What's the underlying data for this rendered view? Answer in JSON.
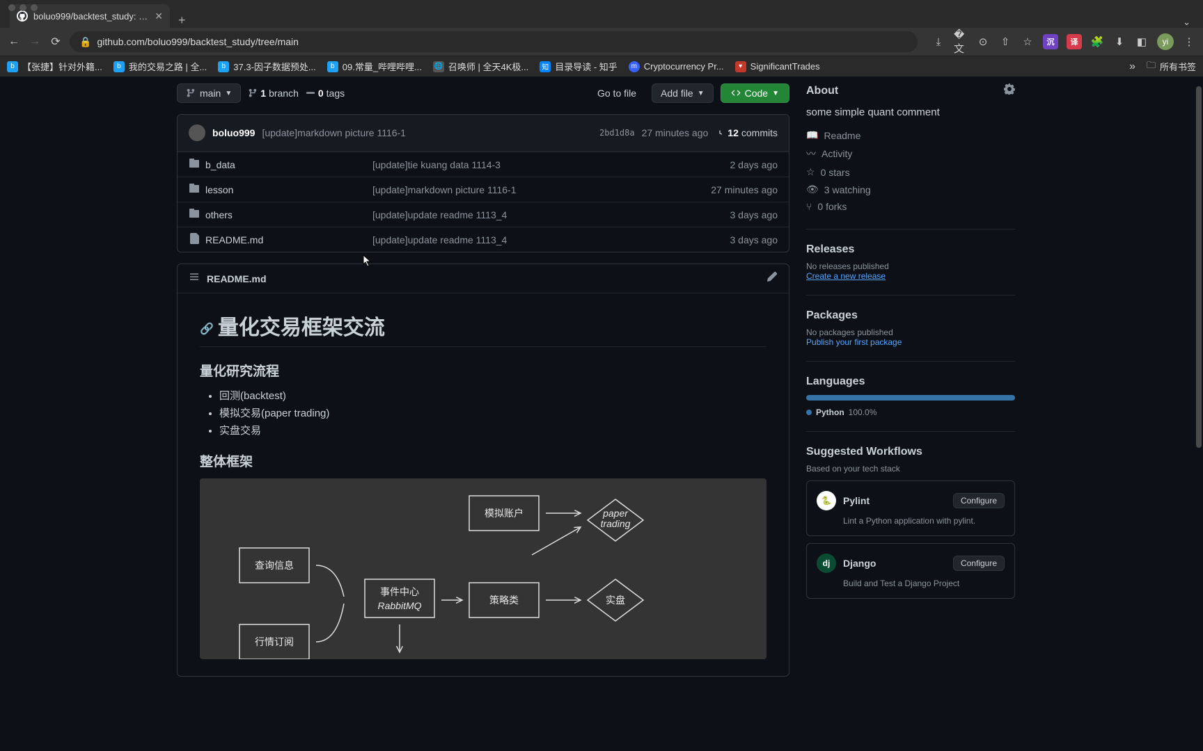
{
  "browser": {
    "tab_title": "boluo999/backtest_study: so…",
    "url": "github.com/boluo999/backtest_study/tree/main"
  },
  "bookmarks": [
    {
      "label": "【张捷】针对外籍...",
      "icon_bg": "#1ea1f2"
    },
    {
      "label": "我的交易之路 | 全...",
      "icon_bg": "#1ea1f2"
    },
    {
      "label": "37.3-因子数据预处...",
      "icon_bg": "#1ea1f2"
    },
    {
      "label": "09.常量_哔哩哔哩...",
      "icon_bg": "#1ea1f2"
    },
    {
      "label": "召唤师 | 全天4K极...",
      "icon_bg": "#555"
    },
    {
      "label": "目录导读 - 知乎",
      "icon_bg": "#0084ff"
    },
    {
      "label": "Cryptocurrency Pr...",
      "icon_bg": "#3861fb"
    },
    {
      "label": "SignificantTrades",
      "icon_bg": "#c0392b"
    }
  ],
  "bookmarks_folder": "所有书签",
  "repo_toolbar": {
    "branch": "main",
    "branches_count": "1",
    "branches_label": "branch",
    "tags_count": "0",
    "tags_label": "tags",
    "go_to_file": "Go to file",
    "add_file": "Add file",
    "code": "Code"
  },
  "commit_header": {
    "user": "boluo999",
    "message": "[update]markdown picture 1116-1",
    "sha": "2bd1d8a",
    "time": "27 minutes ago",
    "commits_count": "12",
    "commits_label": "commits"
  },
  "files": [
    {
      "type": "dir",
      "name": "b_data",
      "msg": "[update]tie kuang data 1114-3",
      "time": "2 days ago"
    },
    {
      "type": "dir",
      "name": "lesson",
      "msg": "[update]markdown picture 1116-1",
      "time": "27 minutes ago"
    },
    {
      "type": "dir",
      "name": "others",
      "msg": "[update]update readme 1113_4",
      "time": "3 days ago"
    },
    {
      "type": "file",
      "name": "README.md",
      "msg": "[update]update readme 1113_4",
      "time": "3 days ago"
    }
  ],
  "readme": {
    "filename": "README.md",
    "h1": "量化交易框架交流",
    "h3a": "量化研究流程",
    "bullets": [
      "回测(backtest)",
      "模拟交易(paper trading)",
      "实盘交易"
    ],
    "h3b": "整体框架",
    "diagram": {
      "box1": "模拟账户",
      "diamond1": "paper trading",
      "box2": "查询信息",
      "box3": "事件中心 RabbitMQ",
      "box4": "策略类",
      "diamond2": "实盘",
      "box5": "行情订阅"
    }
  },
  "sidebar": {
    "about_title": "About",
    "about_desc": "some simple quant comment",
    "links": {
      "readme": "Readme",
      "activity": "Activity",
      "stars": "0 stars",
      "watching": "3 watching",
      "forks": "0 forks"
    },
    "releases_title": "Releases",
    "releases_empty": "No releases published",
    "releases_link": "Create a new release",
    "packages_title": "Packages",
    "packages_empty": "No packages published",
    "packages_link": "Publish your first package",
    "languages_title": "Languages",
    "language_name": "Python",
    "language_pct": "100.0%",
    "workflows_title": "Suggested Workflows",
    "workflows_sub": "Based on your tech stack",
    "workflows": [
      {
        "name": "Pylint",
        "desc": "Lint a Python application with pylint.",
        "btn": "Configure",
        "icon_bg": "#fff",
        "icon_text": "🐍"
      },
      {
        "name": "Django",
        "desc": "Build and Test a Django Project",
        "btn": "Configure",
        "icon_bg": "#0c4b33",
        "icon_text": "dj"
      }
    ]
  }
}
